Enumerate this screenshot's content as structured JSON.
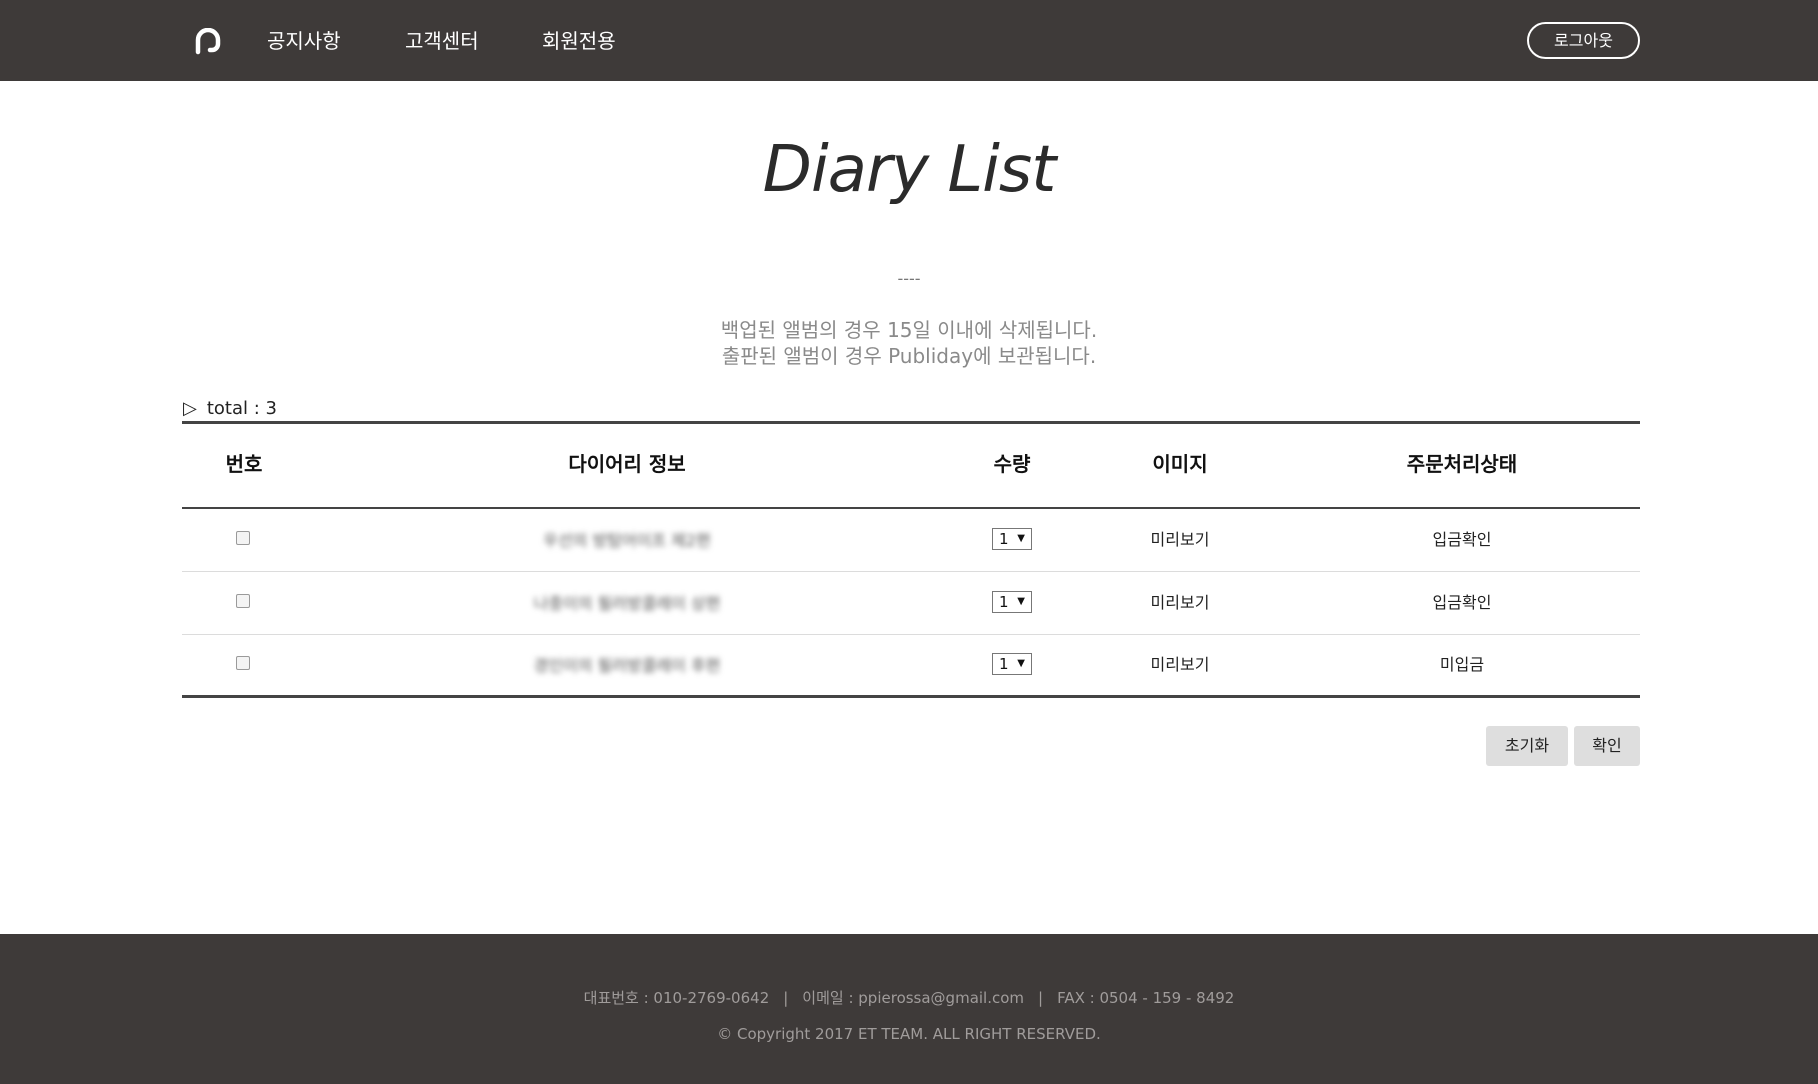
{
  "header": {
    "logo_icon": "brand-logo-icon",
    "nav": [
      {
        "label": "공지사항"
      },
      {
        "label": "고객센터"
      },
      {
        "label": "회원전용"
      }
    ],
    "logout_label": "로그아웃",
    "background_color": "#3e3a39"
  },
  "main": {
    "title": "Diary List",
    "divider": "----",
    "notice_line1": "백업된 앨범의 경우 15일 이내에 삭제됩니다.",
    "notice_line2": "출판된 앨범이 경우 Publiday에 보관됩니다.",
    "total_marker": "▷",
    "total_label": "total : 3"
  },
  "table": {
    "columns": [
      "번호",
      "다이어리 정보",
      "수량",
      "이미지",
      "주문처리상태"
    ],
    "rows": [
      {
        "checked": false,
        "info": "우선의 방탐어이프 제2편",
        "qty": "1",
        "image": "미리보기",
        "status": "입금확인"
      },
      {
        "checked": false,
        "info": "나중이의 필러방콜레이 상편",
        "qty": "1",
        "image": "미리보기",
        "status": "입금확인"
      },
      {
        "checked": false,
        "info": "경인이의 필러방콜레이 후편",
        "qty": "1",
        "image": "미리보기",
        "status": "미입금"
      }
    ]
  },
  "actions": {
    "reset_label": "초기화",
    "confirm_label": "확인"
  },
  "footer": {
    "phone": "대표번호 : 010-2769-0642",
    "separator": "|",
    "email": "이메일 : ppierossa@gmail.com",
    "fax": "FAX : 0504 - 159 - 8492",
    "copyright": "© Copyright 2017 ET TEAM. ALL RIGHT RESERVED.",
    "background_color": "#3e3a39"
  }
}
